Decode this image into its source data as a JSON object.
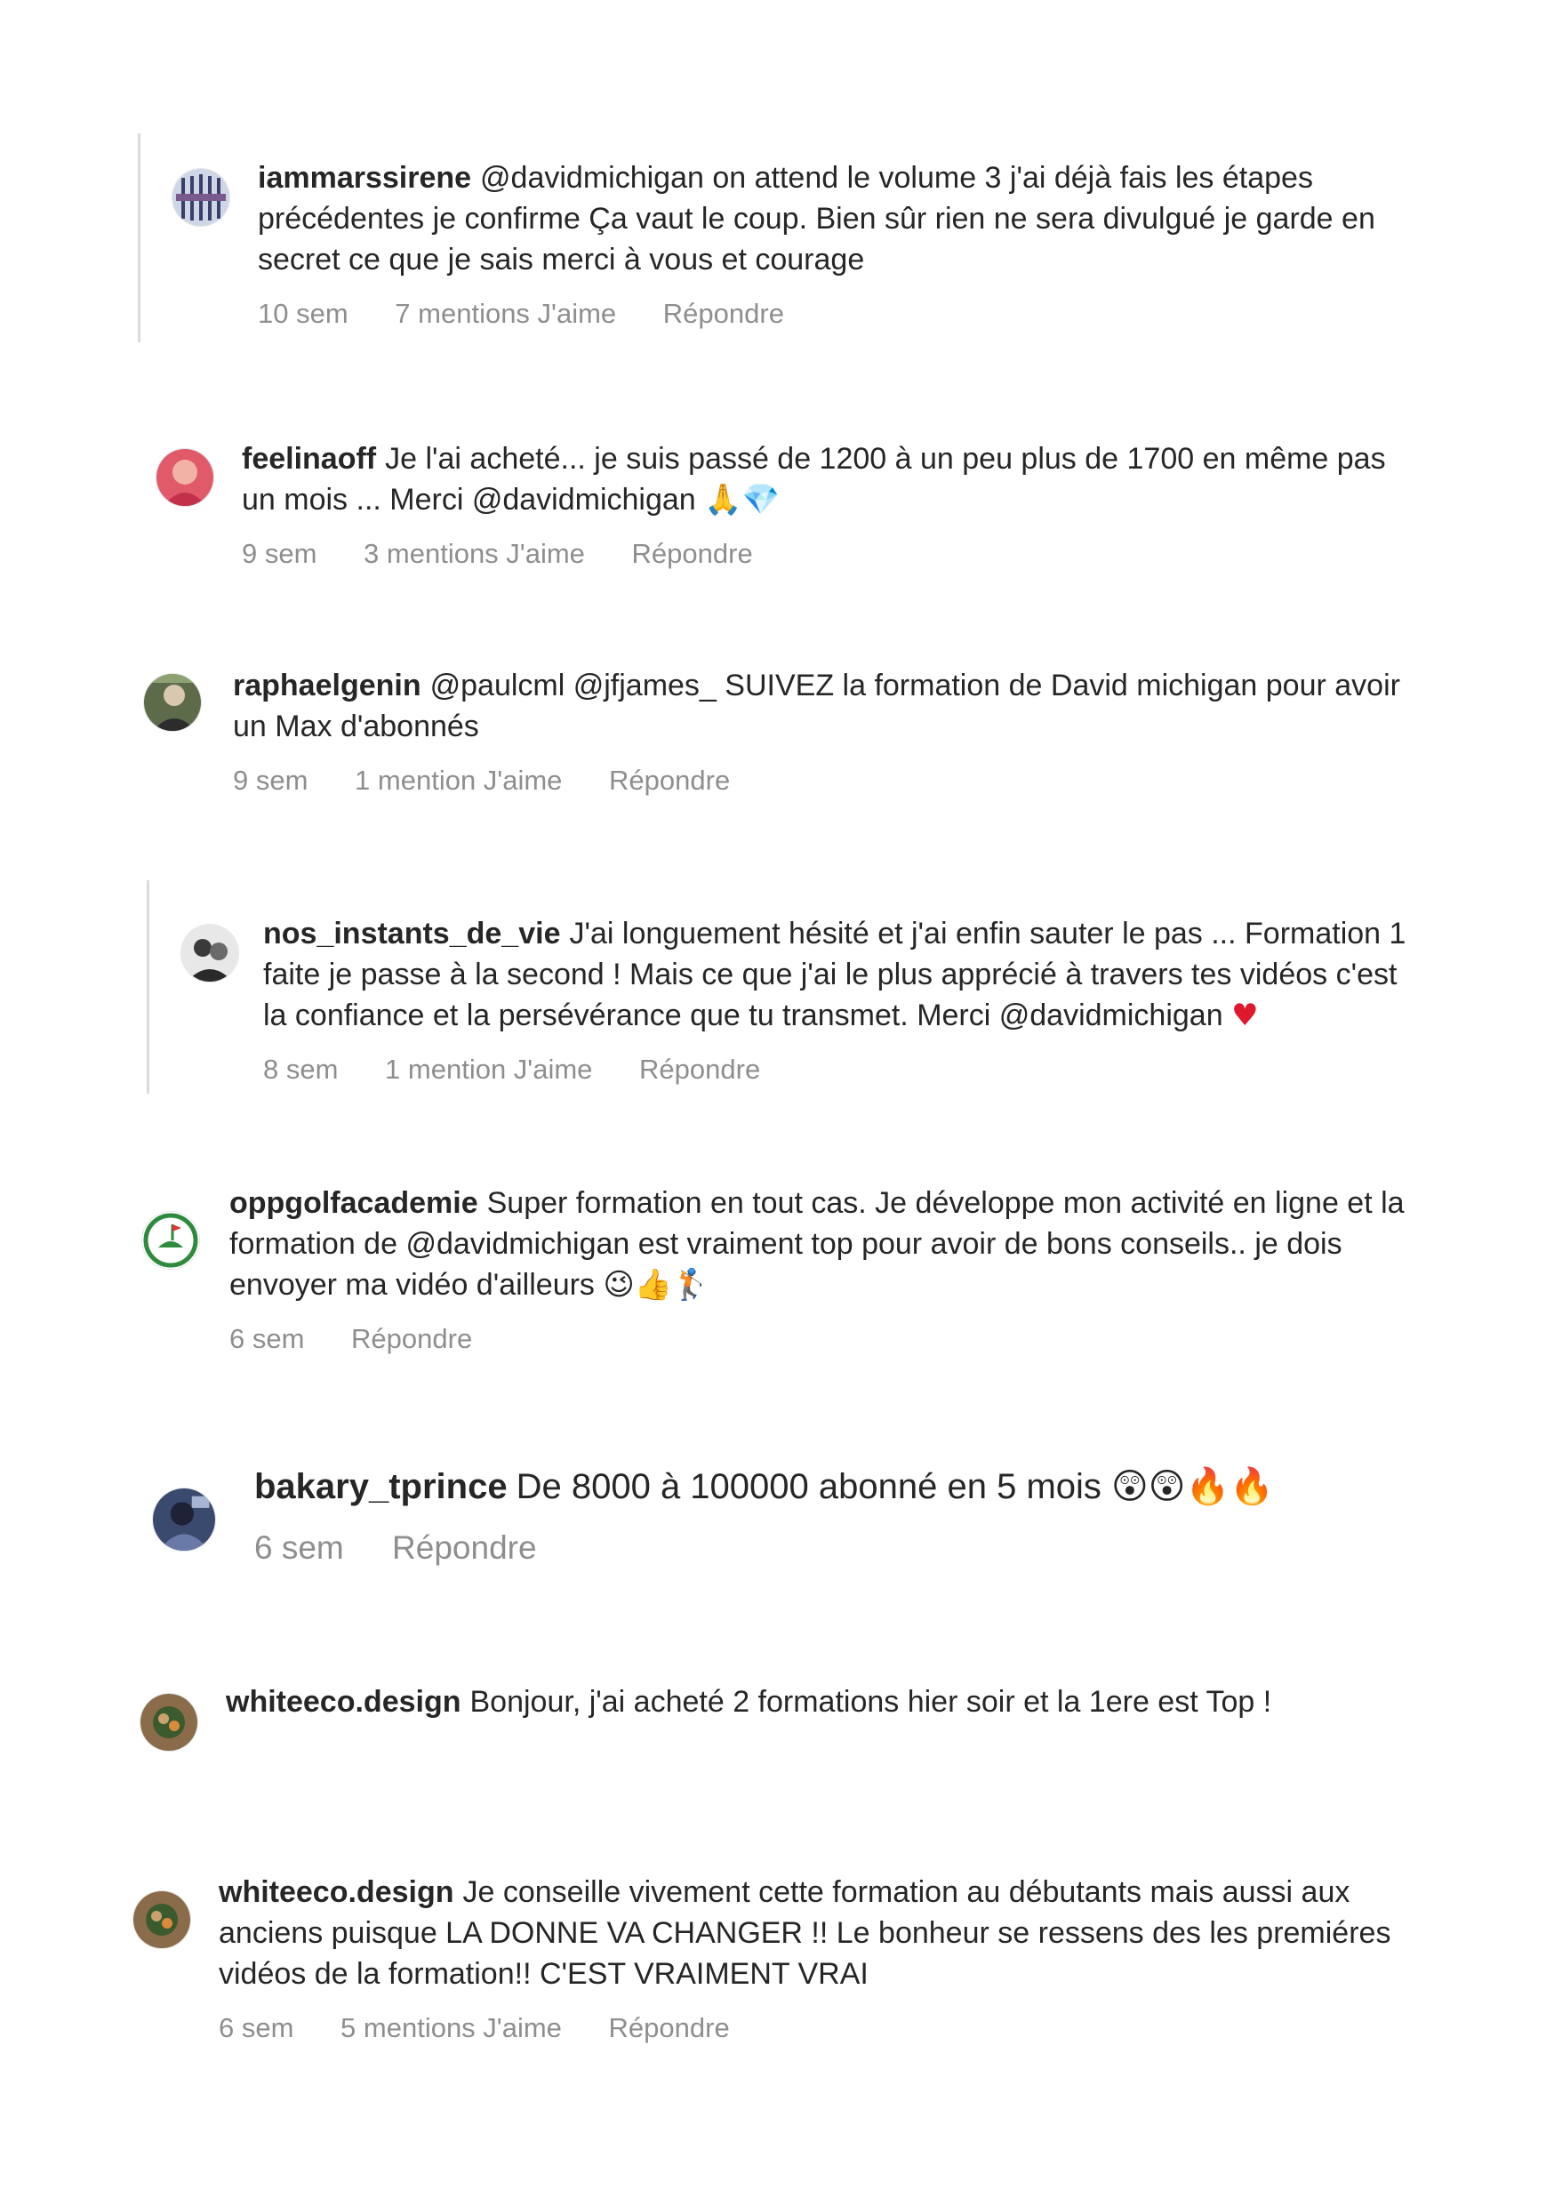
{
  "comments": [
    {
      "username": "iammarssirene",
      "text": "@davidmichigan on attend le volume 3 j'ai déjà fais les étapes précédentes je confirme Ça vaut le coup. Bien sûr rien ne sera divulgué je garde en secret ce que je sais merci à vous et courage",
      "time": "10 sem",
      "likes": "7 mentions J'aime",
      "reply": "Répondre"
    },
    {
      "username": "feelinaoff",
      "text": "Je l'ai acheté... je suis passé de 1200 à un peu plus de 1700 en même pas un mois ... Merci @davidmichigan",
      "emojis": [
        "🙏",
        "💎"
      ],
      "time": "9 sem",
      "likes": "3 mentions J'aime",
      "reply": "Répondre"
    },
    {
      "username": "raphaelgenin",
      "text": "@paulcml @jfjames_ SUIVEZ la formation de David michigan pour avoir un Max d'abonnés",
      "time": "9 sem",
      "likes": "1 mention J'aime",
      "reply": "Répondre"
    },
    {
      "username": "nos_instants_de_vie",
      "text": "J'ai longuement hésité et j'ai enfin sauter le pas ... Formation 1 faite je passe à la second ! Mais ce que j'ai le plus apprécié à travers tes vidéos c'est la confiance et la persévérance que tu transmet. Merci @davidmichigan",
      "emojis": [
        "♥"
      ],
      "time": "8 sem",
      "likes": "1 mention J'aime",
      "reply": "Répondre"
    },
    {
      "username": "oppgolfacademie",
      "text": "Super formation en tout cas. Je développe mon activité en ligne et la formation de @davidmichigan est vraiment top pour avoir de bons conseils.. je dois envoyer ma vidéo d'ailleurs",
      "emojis": [
        "😉",
        "👍",
        "🏌"
      ],
      "time": "6 sem",
      "reply": "Répondre"
    },
    {
      "username": "bakary_tprince",
      "text": "De 8000 à 100000 abonné en 5 mois",
      "emojis": [
        "😲",
        "😲",
        "🔥",
        "🔥"
      ],
      "time": "6 sem",
      "reply": "Répondre"
    },
    {
      "username": "whiteeco.design",
      "text": "Bonjour, j'ai acheté 2 formations hier soir et la 1ere est Top !"
    },
    {
      "username": "whiteeco.design",
      "text": "Je conseille vivement cette formation au débutants mais aussi aux anciens puisque LA DONNE VA CHANGER !! Le bonheur se ressens des les premiéres vidéos de la formation!! C'EST VRAIMENT VRAI",
      "time": "6 sem",
      "likes": "5 mentions J'aime",
      "reply": "Répondre"
    }
  ],
  "colors": {
    "text": "#262626",
    "meta": "#8e8e8e",
    "thread_line": "#dbdbdb"
  }
}
